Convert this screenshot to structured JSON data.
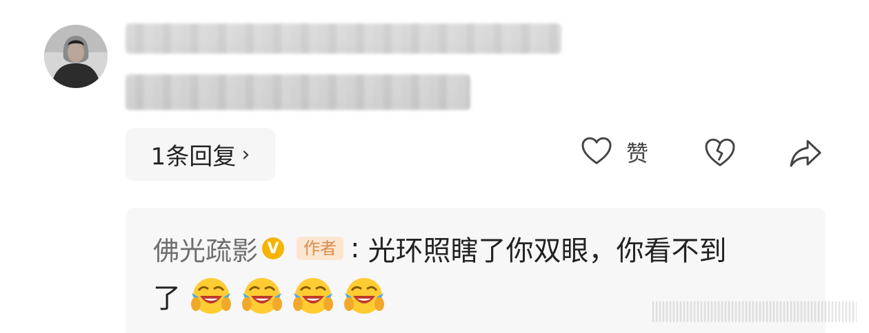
{
  "comment": {
    "reply_count_label": "1条回复",
    "reply_chevron": "›",
    "actions": {
      "like_label": "赞",
      "like_icon": "heart-outline-icon",
      "dislike_icon": "broken-heart-icon",
      "share_icon": "share-arrow-icon"
    }
  },
  "reply": {
    "author": "佛光疏影",
    "verified_mark": "V",
    "badge": "作者",
    "separator": ":",
    "text_line1": "光环照瞎了你双眼，你看不到",
    "text_line2": "了",
    "emoji": "laugh-cry-emoji",
    "emoji_count": 4
  },
  "colors": {
    "pill_bg": "#f6f6f6",
    "reply_bg": "#f7f7f7",
    "verified": "#f6b400",
    "badge_bg": "#fbe6d2",
    "badge_text": "#d98c4a"
  }
}
